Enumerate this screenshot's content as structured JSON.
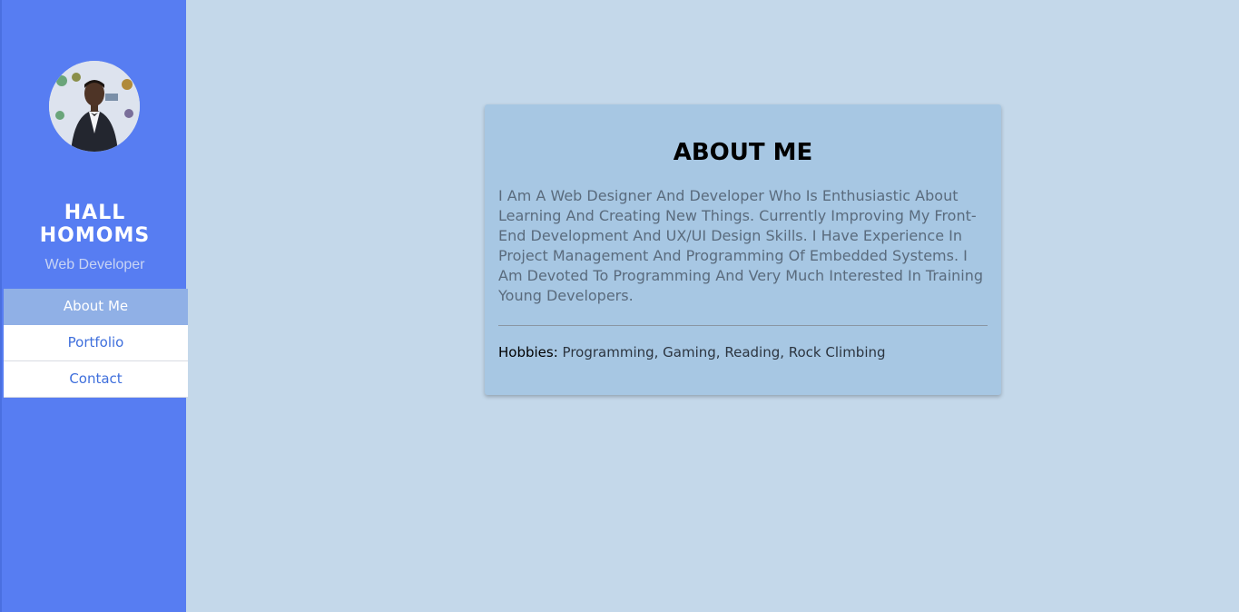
{
  "sidebar": {
    "name": "HALL HOMOMS",
    "role": "Web Developer",
    "avatar_icon": "profile-photo",
    "nav": [
      {
        "label": "About Me",
        "active": true
      },
      {
        "label": "Portfolio",
        "active": false
      },
      {
        "label": "Contact",
        "active": false
      }
    ]
  },
  "main": {
    "title": "ABOUT ME",
    "bio": "I Am A Web Designer And Developer Who Is Enthusiastic About Learning And Creating New Things. Currently Improving My Front-End Development And UX/UI Design Skills. I Have Experience In Project Management And Programming Of Embedded Systems. I Am Devoted To Programming And Very Much Interested In Training Young Developers.",
    "hobbies_label": "Hobbies:",
    "hobbies_value": "Programming, Gaming, Reading, Rock Climbing"
  },
  "colors": {
    "sidebar": "#577df2",
    "page_background": "#c4d8ea",
    "card": "#a7c7e3",
    "nav_active": "#90b0e6",
    "nav_text": "#3f6fdc"
  }
}
